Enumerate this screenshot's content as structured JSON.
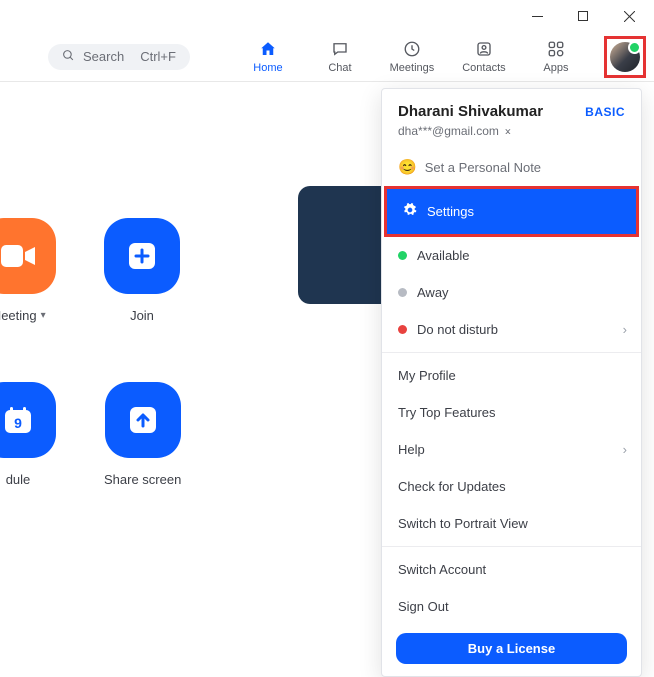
{
  "titlebar": {
    "minimize": "–",
    "maximize": "▢",
    "close": "×"
  },
  "search": {
    "label": "Search",
    "shortcut": "Ctrl+F"
  },
  "tabs": {
    "home": "Home",
    "chat": "Chat",
    "meetings": "Meetings",
    "contacts": "Contacts",
    "apps": "Apps"
  },
  "tiles": {
    "meeting": "Meeting",
    "join": "Join",
    "schedule": "dule",
    "share": "Share screen",
    "cal_day": "9"
  },
  "menu": {
    "name": "Dharani Shivakumar",
    "plan": "BASIC",
    "email": "dha***@gmail.com",
    "note": "Set a Personal Note",
    "settings": "Settings",
    "available": "Available",
    "away": "Away",
    "dnd": "Do not disturb",
    "profile": "My Profile",
    "topfeat": "Try Top Features",
    "help": "Help",
    "updates": "Check for Updates",
    "portrait": "Switch to Portrait View",
    "switch": "Switch Account",
    "signout": "Sign Out",
    "buy": "Buy a License"
  }
}
